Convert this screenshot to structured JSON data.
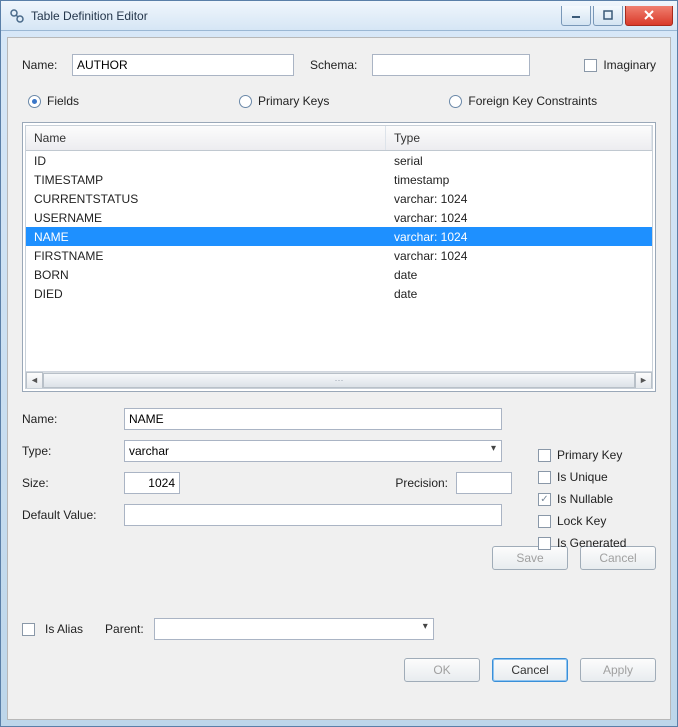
{
  "window": {
    "title": "Table Definition Editor"
  },
  "header": {
    "name_label": "Name:",
    "name_value": "AUTHOR",
    "schema_label": "Schema:",
    "schema_value": "",
    "imaginary_label": "Imaginary",
    "imaginary_checked": false
  },
  "view_tabs": {
    "fields": "Fields",
    "primary_keys": "Primary Keys",
    "foreign_keys": "Foreign Key Constraints",
    "selected": "fields"
  },
  "table": {
    "columns": {
      "name": "Name",
      "type": "Type"
    },
    "rows": [
      {
        "name": "ID",
        "type": "serial",
        "selected": false
      },
      {
        "name": "TIMESTAMP",
        "type": "timestamp",
        "selected": false
      },
      {
        "name": "CURRENTSTATUS",
        "type": "varchar: 1024",
        "selected": false
      },
      {
        "name": "USERNAME",
        "type": "varchar: 1024",
        "selected": false
      },
      {
        "name": "NAME",
        "type": "varchar: 1024",
        "selected": true
      },
      {
        "name": "FIRSTNAME",
        "type": "varchar: 1024",
        "selected": false
      },
      {
        "name": "BORN",
        "type": "date",
        "selected": false
      },
      {
        "name": "DIED",
        "type": "date",
        "selected": false
      }
    ]
  },
  "detail": {
    "name_label": "Name:",
    "name_value": "NAME",
    "type_label": "Type:",
    "type_value": "varchar",
    "size_label": "Size:",
    "size_value": "1024",
    "precision_label": "Precision:",
    "precision_value": "",
    "default_label": "Default Value:",
    "default_value": ""
  },
  "flags": {
    "primary_key": {
      "label": "Primary Key",
      "checked": false
    },
    "is_unique": {
      "label": "Is Unique",
      "checked": false
    },
    "is_nullable": {
      "label": "Is Nullable",
      "checked": true
    },
    "lock_key": {
      "label": "Lock Key",
      "checked": false
    },
    "is_generated": {
      "label": "Is Generated",
      "checked": false
    }
  },
  "detail_buttons": {
    "save": "Save",
    "cancel": "Cancel"
  },
  "alias": {
    "is_alias_label": "Is Alias",
    "is_alias_checked": false,
    "parent_label": "Parent:",
    "parent_value": ""
  },
  "footer": {
    "ok": "OK",
    "cancel": "Cancel",
    "apply": "Apply"
  }
}
